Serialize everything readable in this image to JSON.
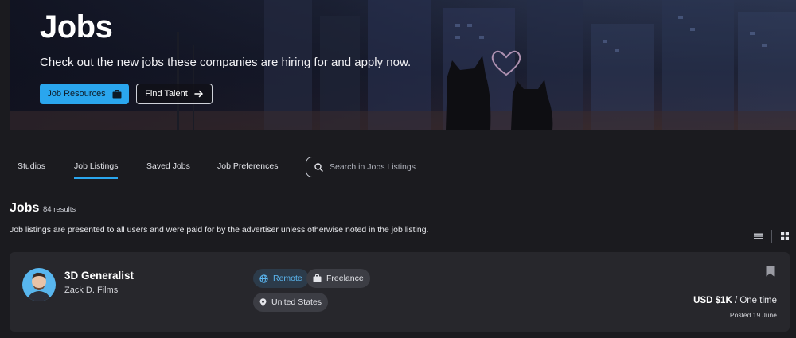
{
  "hero": {
    "title": "Jobs",
    "subtitle": "Check out the new jobs these companies are hiring for and apply now.",
    "primary_button": {
      "label": "Job Resources",
      "icon": "briefcase-icon"
    },
    "secondary_button": {
      "label": "Find Talent",
      "icon": "arrow-right-icon"
    }
  },
  "tabs": [
    {
      "label": "Studios",
      "active": false
    },
    {
      "label": "Job Listings",
      "active": true
    },
    {
      "label": "Saved Jobs",
      "active": false
    },
    {
      "label": "Job Preferences",
      "active": false
    }
  ],
  "search": {
    "placeholder": "Search in Jobs Listings",
    "value": ""
  },
  "listing": {
    "title": "Jobs",
    "count": "84 results",
    "disclaimer": "Job listings are presented to all users and were paid for by the advertiser unless otherwise noted in the job listing.",
    "views": [
      "list-view-icon",
      "grid-view-icon"
    ]
  },
  "jobs": [
    {
      "title": "3D Generalist",
      "company": "Zack D. Films",
      "tags": {
        "remote": "Remote",
        "type": "Freelance",
        "location": "United States"
      },
      "salary": {
        "amount": "USD $1K",
        "period": " / One time"
      },
      "posted": "Posted 19 June"
    }
  ],
  "colors": {
    "accent": "#2aa6ee",
    "background": "#1b1b1f",
    "card": "#27272c",
    "chip": "#3c3d44"
  }
}
